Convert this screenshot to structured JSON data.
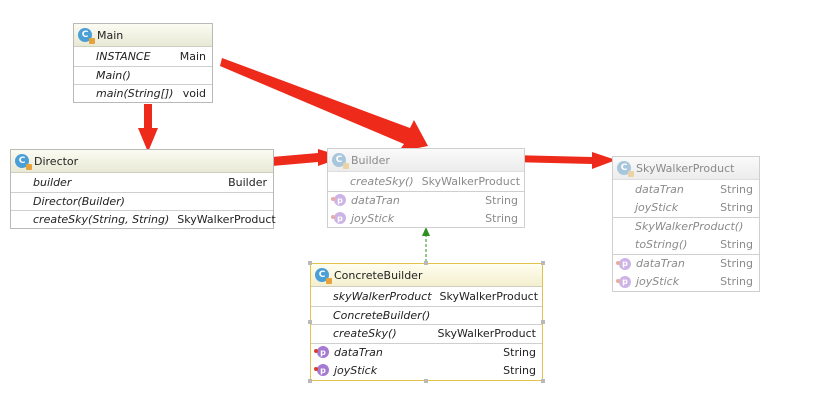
{
  "main": {
    "name": "Main",
    "fields": [
      {
        "name": "INSTANCE",
        "type": "Main"
      }
    ],
    "methods": [
      {
        "name": "Main()",
        "type": ""
      },
      {
        "name": "main(String[])",
        "type": "void"
      }
    ]
  },
  "director": {
    "name": "Director",
    "fields": [
      {
        "name": "builder",
        "type": "Builder"
      }
    ],
    "methods": [
      {
        "name": "Director(Builder)",
        "type": ""
      },
      {
        "name": "createSky(String, String)",
        "type": "SkyWalkerProduct"
      }
    ]
  },
  "builder": {
    "name": "Builder",
    "methods": [
      {
        "name": "createSky()",
        "type": "SkyWalkerProduct"
      }
    ],
    "fields": [
      {
        "name": "dataTran",
        "type": "String"
      },
      {
        "name": "joyStick",
        "type": "String"
      }
    ]
  },
  "concrete_builder": {
    "name": "ConcreteBuilder",
    "fields": [
      {
        "name": "skyWalkerProduct",
        "type": "SkyWalkerProduct"
      }
    ],
    "methods": [
      {
        "name": "ConcreteBuilder()",
        "type": ""
      },
      {
        "name": "createSky()",
        "type": "SkyWalkerProduct"
      }
    ],
    "inherited": [
      {
        "name": "dataTran",
        "type": "String"
      },
      {
        "name": "joyStick",
        "type": "String"
      }
    ]
  },
  "sky_walker_product": {
    "name": "SkyWalkerProduct",
    "fields": [
      {
        "name": "dataTran",
        "type": "String"
      },
      {
        "name": "joyStick",
        "type": "String"
      }
    ],
    "methods": [
      {
        "name": "SkyWalkerProduct()",
        "type": ""
      },
      {
        "name": "toString()",
        "type": "String"
      }
    ],
    "inherited": [
      {
        "name": "dataTran",
        "type": "String"
      },
      {
        "name": "joyStick",
        "type": "String"
      }
    ]
  },
  "icons": {
    "class_icon": "class-c-icon",
    "field_icon": "protected-field-p-icon",
    "class_letter": "C",
    "field_letter": "p"
  },
  "colors": {
    "arrow_red": "#ee2a1a",
    "generalization_green": "#2f8f1f",
    "class_icon": "#4a9fd6",
    "field_icon": "#a57ad3",
    "selection_border": "#e2c24a"
  }
}
